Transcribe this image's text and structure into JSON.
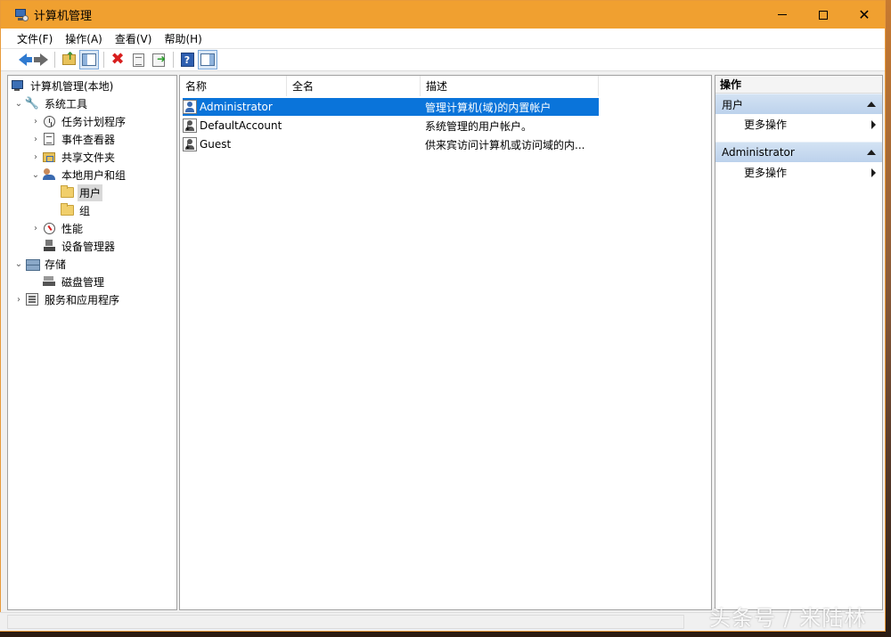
{
  "window": {
    "title": "计算机管理",
    "accent_color": "#f0a030",
    "controls": {
      "minimize": "minimize-icon",
      "maximize": "maximize-icon",
      "close": "close-icon"
    }
  },
  "menu": [
    "文件(F)",
    "操作(A)",
    "查看(V)",
    "帮助(H)"
  ],
  "toolbar": {
    "icons": [
      "back-arrow-icon",
      "forward-arrow-icon",
      "up-folder-icon",
      "show-hide-tree-icon",
      "delete-icon",
      "properties-icon",
      "export-list-icon",
      "help-icon",
      "show-hide-action-pane-icon"
    ]
  },
  "tree": {
    "root": "计算机管理(本地)",
    "system_tools": "系统工具",
    "task_scheduler": "任务计划程序",
    "event_viewer": "事件查看器",
    "shared_folders": "共享文件夹",
    "local_users_groups": "本地用户和组",
    "users": "用户",
    "groups": "组",
    "performance": "性能",
    "device_manager": "设备管理器",
    "storage": "存储",
    "disk_management": "磁盘管理",
    "services_apps": "服务和应用程序",
    "expanders": {
      "collapsed": "›",
      "expanded": "⌄"
    }
  },
  "list": {
    "columns": [
      "名称",
      "全名",
      "描述"
    ],
    "rows": [
      {
        "name": "Administrator",
        "full_name": "",
        "description": "管理计算机(域)的内置帐户",
        "selected": true
      },
      {
        "name": "DefaultAccount",
        "full_name": "",
        "description": "系统管理的用户帐户。",
        "selected": false
      },
      {
        "name": "Guest",
        "full_name": "",
        "description": "供来宾访问计算机或访问域的内...",
        "selected": false
      }
    ],
    "selection_color": "#0a74da"
  },
  "actions": {
    "title": "操作",
    "sections": [
      {
        "header": "用户",
        "item": "更多操作"
      },
      {
        "header": "Administrator",
        "item": "更多操作"
      }
    ]
  },
  "watermark": "头条号 / 米陆林"
}
